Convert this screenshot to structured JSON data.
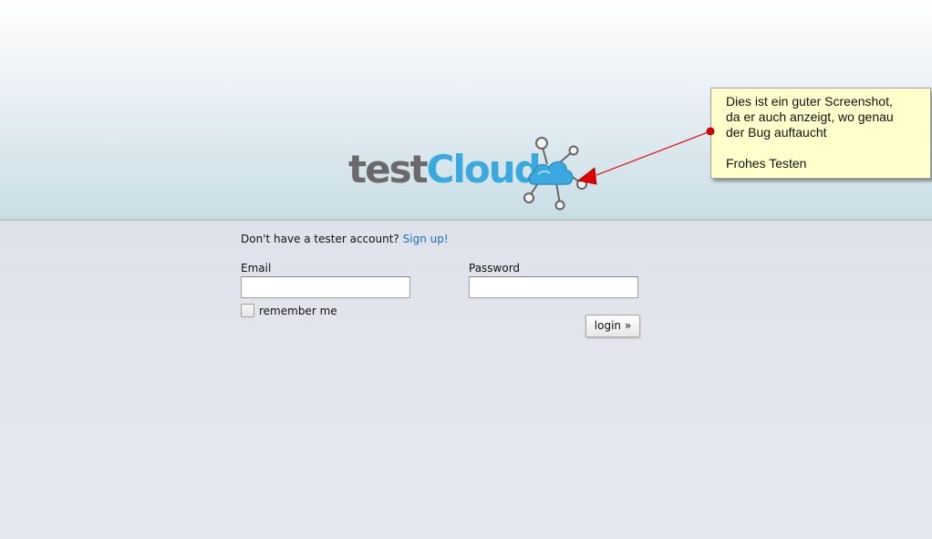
{
  "logo": {
    "text_part1": "test",
    "text_part2": "Cloud",
    "color_test": "#6a6a6a",
    "color_cloud": "#3aa9df"
  },
  "annotation": {
    "lines": [
      "Dies ist ein guter Screenshot,",
      "da er auch anzeigt, wo genau",
      "der Bug auftaucht"
    ],
    "closing": "Frohes Testen",
    "arrow_color": "#e00000"
  },
  "signup": {
    "prompt": "Don't have a tester account?",
    "link": "Sign up!"
  },
  "form": {
    "email_label": "Email",
    "email_value": "",
    "password_label": "Password",
    "password_value": "",
    "remember_label": "remember me",
    "remember_checked": false,
    "login_button": "login »"
  }
}
